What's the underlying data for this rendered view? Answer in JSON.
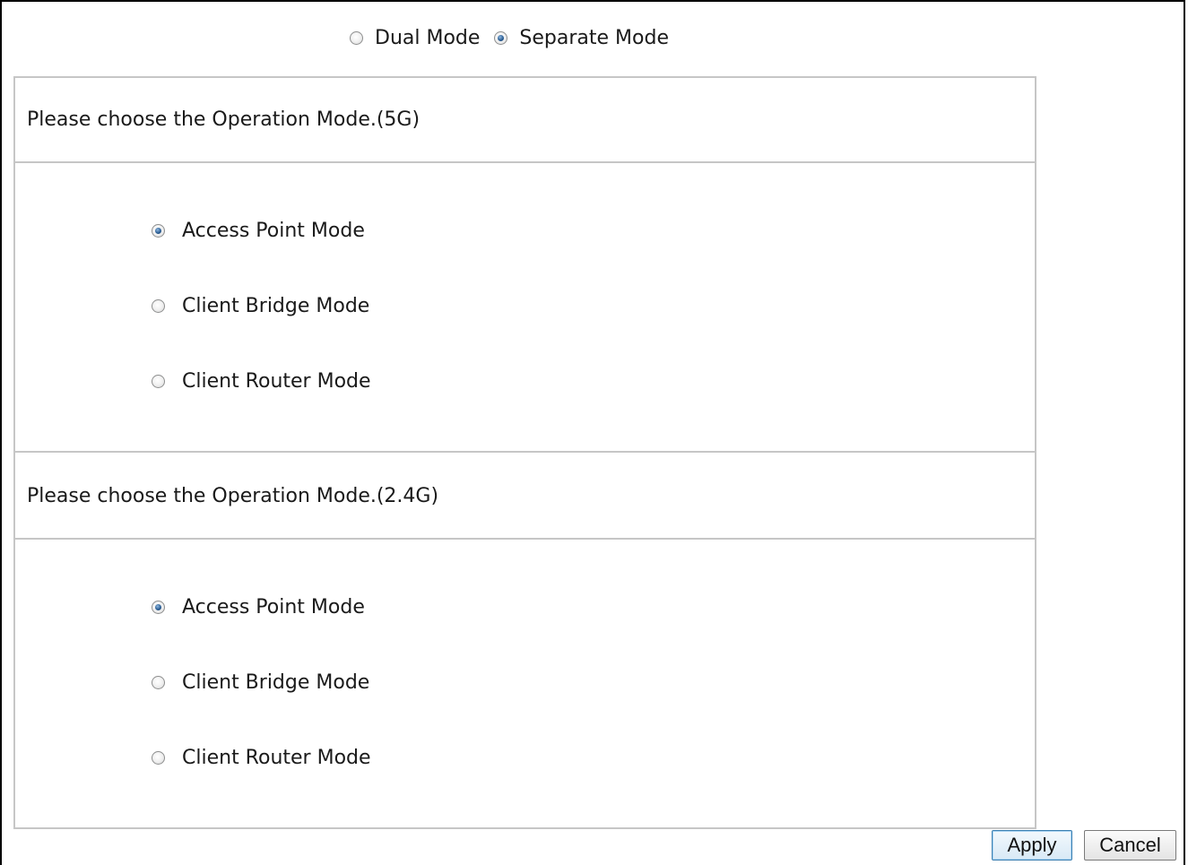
{
  "wireless_mode": {
    "options": [
      {
        "label": "Dual Mode",
        "checked": false
      },
      {
        "label": "Separate Mode",
        "checked": true
      }
    ]
  },
  "sections": [
    {
      "heading": "Please choose the Operation Mode.(5G)",
      "options": [
        {
          "label": "Access Point Mode",
          "checked": true
        },
        {
          "label": "Client Bridge Mode",
          "checked": false
        },
        {
          "label": "Client Router Mode",
          "checked": false
        }
      ]
    },
    {
      "heading": "Please choose the Operation Mode.(2.4G)",
      "options": [
        {
          "label": "Access Point Mode",
          "checked": true
        },
        {
          "label": "Client Bridge Mode",
          "checked": false
        },
        {
          "label": "Client Router Mode",
          "checked": false
        }
      ]
    }
  ],
  "buttons": {
    "apply_label": "Apply",
    "cancel_label": "Cancel"
  }
}
